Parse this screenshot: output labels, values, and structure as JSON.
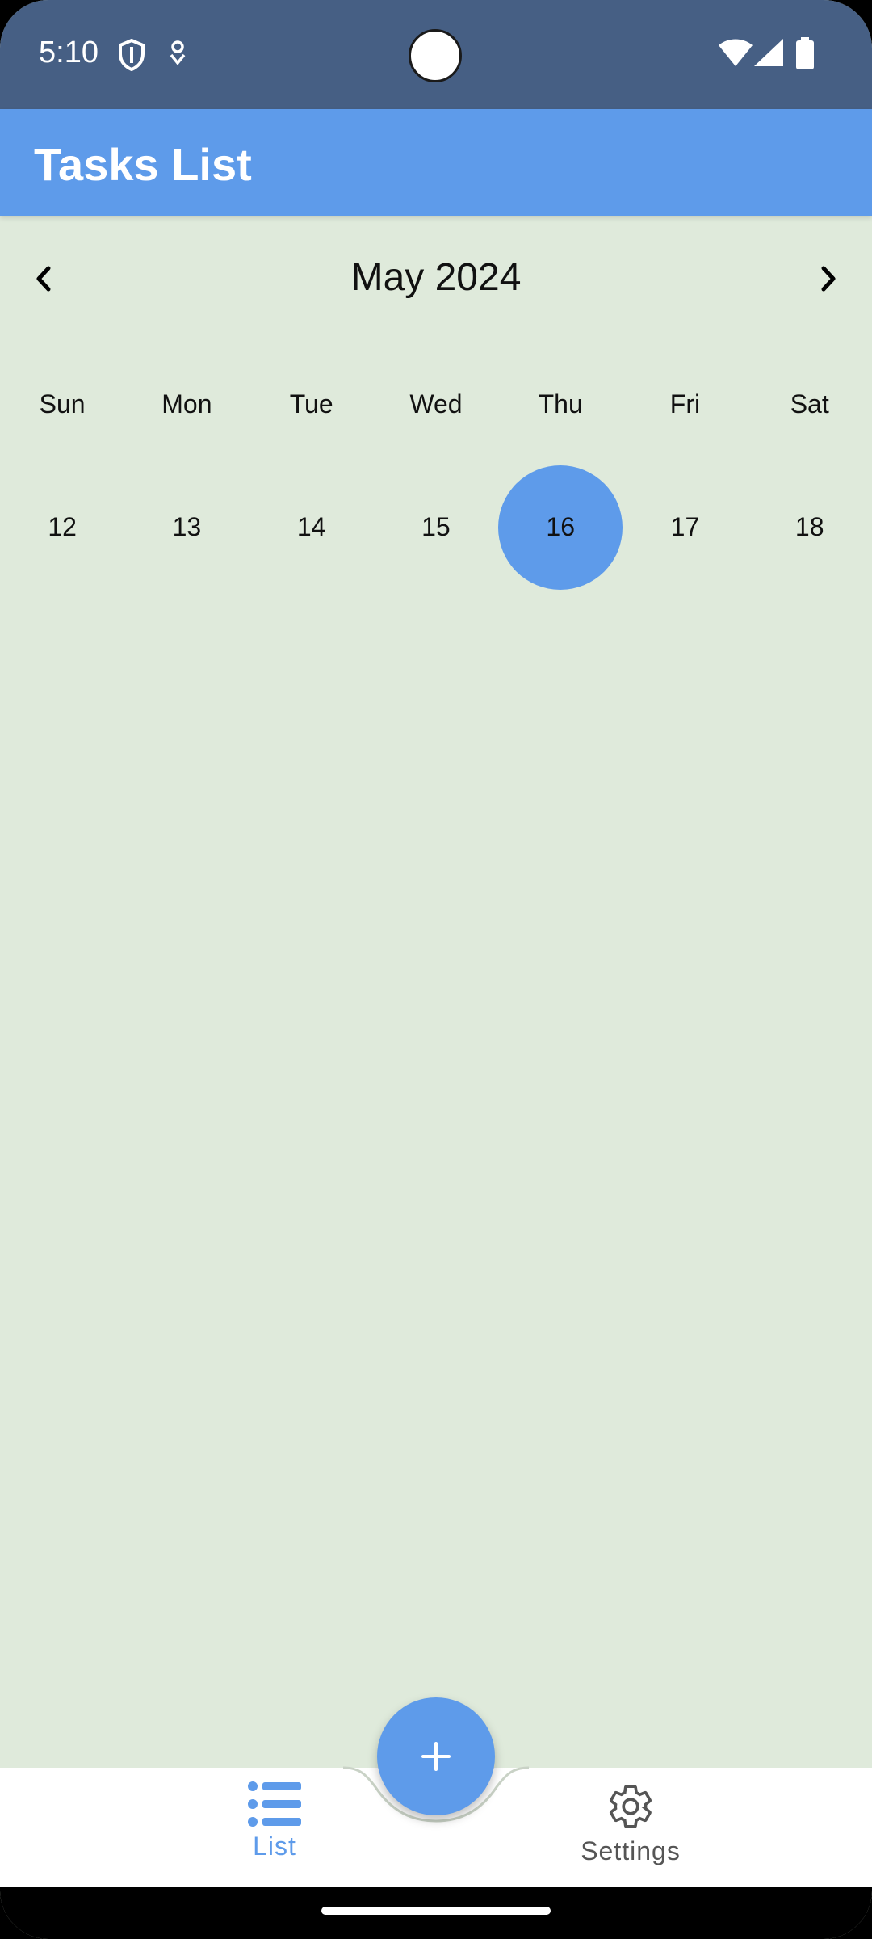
{
  "status_bar": {
    "time": "5:10",
    "icons": [
      "shield-icon",
      "location-pin-icon",
      "wifi-icon",
      "signal-icon",
      "battery-icon"
    ]
  },
  "app_bar": {
    "title": "Tasks List",
    "color": "#5e9bea"
  },
  "calendar": {
    "month_label": "May 2024",
    "weekdays": [
      "Sun",
      "Mon",
      "Tue",
      "Wed",
      "Thu",
      "Fri",
      "Sat"
    ],
    "days": [
      "12",
      "13",
      "14",
      "15",
      "16",
      "17",
      "18"
    ],
    "selected_day": "16",
    "selected_color": "#5e9bea"
  },
  "bottom_nav": {
    "items": [
      {
        "label": "List",
        "icon": "list-icon",
        "active": true,
        "color": "#5e9bea"
      },
      {
        "label": "Settings",
        "icon": "gear-icon",
        "active": false,
        "color": "#555555"
      }
    ],
    "fab_icon": "plus-icon"
  },
  "colors": {
    "status_bar": "#465f84",
    "background": "#dfeadb"
  }
}
